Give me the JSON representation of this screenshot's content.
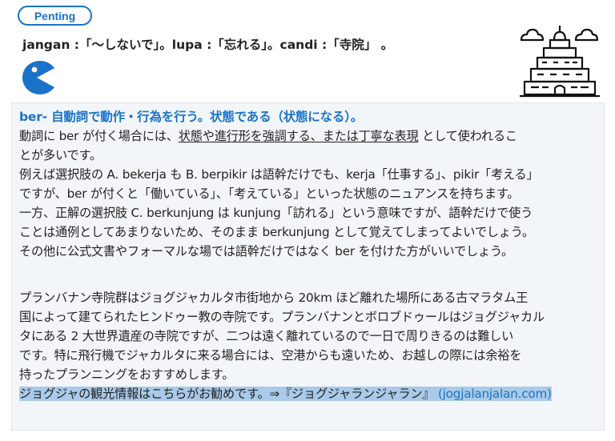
{
  "badge": {
    "label": "Penting"
  },
  "vocab": {
    "text": "jangan :「〜しないで」。lupa :「忘れる」。candi :「寺院」 。"
  },
  "panel": {
    "heading": "ber- 自動詞で動作・行為を行う。状態である（状態になる）。",
    "p1_l1_a": "動詞に ber が付く場合には、",
    "p1_l1_u": "状態や進行形を強調する、または丁寧な表現",
    "p1_l1_b": " として使われるこ",
    "p1_l2": "とが多いです。",
    "p1_l3": "例えば選択肢の A. bekerja も B. berpikir は語幹だけでも、kerja「仕事する」、pikir「考える」",
    "p1_l4": "ですが、ber が付くと「働いている」、「考えている」といった状態のニュアンスを持ちます。",
    "p1_l5": "一方、正解の選択肢 C. berkunjung は kunjung「訪れる」という意味ですが、語幹だけで使う",
    "p1_l6": "ことは通例としてあまりないため、そのまま berkunjung として覚えてしまってよいでしょう。",
    "p1_l7": "その他に公式文書やフォーマルな場では語幹だけではなく ber を付けた方がいいでしょう。",
    "p2_l1": "プランバナン寺院群はジョグジャカルタ市街地から 20km ほど離れた場所にある古マラタム王",
    "p2_l2": "国によって建てられたヒンドゥー教の寺院です。プランバナンとボロブドゥールはジョグジャカル",
    "p2_l3": "タにある 2 大世界遺産の寺院ですが、二つは遠く離れているので一日で周りきるのは難しい",
    "p2_l4": "です。特に飛行機でジャカルタに来る場合には、空港からも遠いため、お越しの際には余裕を",
    "p2_l5": "持ったプランニングをおすすめします。",
    "promo_text": "ジョグジャの観光情報はこちらがお勧めです。⇒『ジョグジャランジャラン』",
    "promo_link": "(jogjalanjalan.com)"
  },
  "icons": {
    "pacman": "pacman-icon",
    "temple": "temple-icon"
  },
  "colors": {
    "accent": "#1a73c9",
    "panel_bg": "#f3f6f9",
    "highlight": "#a9cae8"
  }
}
